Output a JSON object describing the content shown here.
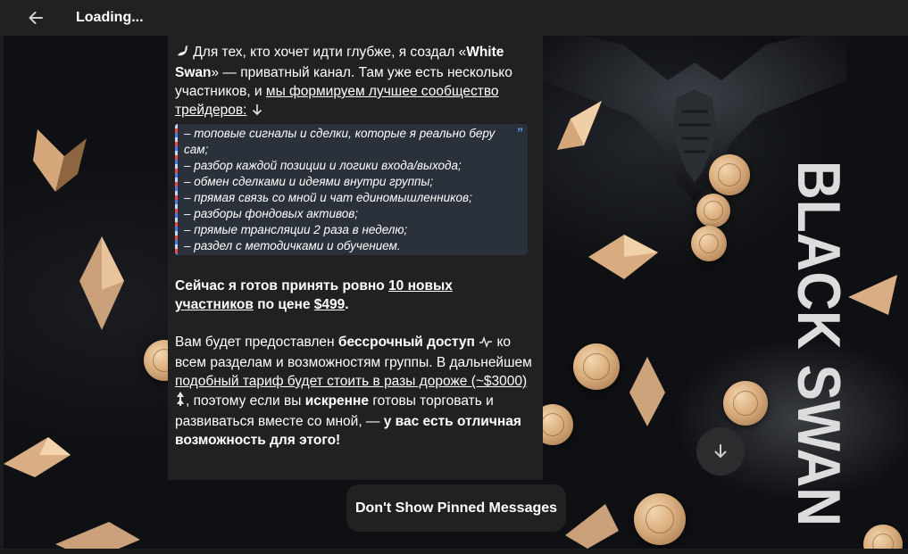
{
  "header": {
    "title": "Loading..."
  },
  "message": {
    "intro_before": " Для тех, кто хочет идти глубже, я создал «",
    "intro_bold": "White Swan",
    "intro_mid": "» — приватный канал. Там уже есть несколько участников, и ",
    "intro_link": "мы формируем лучшее сообщество трейдеров:",
    "quote_lines": [
      "– топовые сигналы и сделки, которые я реально беру сам;",
      "– разбор каждой позиции и логики входа/выхода;",
      "– обмен сделками и идеями внутри группы;",
      "– прямая связь со мной и чат единомышленников;",
      "– разборы фондовых активов;",
      "– прямые трансляции 2 раза в неделю;",
      "– раздел с методичками и обучением."
    ],
    "offer_before": "Сейчас я готов принять ровно ",
    "offer_link": "10 новых участников",
    "offer_mid": " по цене ",
    "offer_price": "$499",
    "offer_end": ".",
    "p3_a": "Вам будет предоставлен ",
    "p3_b": "бессрочный доступ",
    "p3_c": " ко всем разделам и возможностям группы. В дальнейшем ",
    "p3_d": "подобный тариф будет стоить в разы дороже (~$3000)",
    "p3_e": ", поэтому если вы ",
    "p3_f": "искренне",
    "p3_g": " готовы торговать и развиваться вместе со мной, — ",
    "p3_h": "у вас есть отличная возможность для этого!"
  },
  "background": {
    "brand_text": "BLACK SWAN"
  },
  "pinned_pill": {
    "label": "Don't Show Pinned Messages"
  },
  "icons": {
    "back": "arrow-left-icon",
    "scroll_down": "arrow-down-icon",
    "quote": "quote-icon",
    "swan": "swan-emoji-icon",
    "arrow_down_emoji": "arrow-down-emoji-icon",
    "pulse": "pulse-emoji-icon",
    "chart": "chart-emoji-icon"
  },
  "colors": {
    "header_bg": "#212121",
    "bubble_bg": "#212121",
    "quote_bg": "#2a313a",
    "quote_accent": "#5f9fef",
    "coin_gold": "#d9ac7c"
  }
}
